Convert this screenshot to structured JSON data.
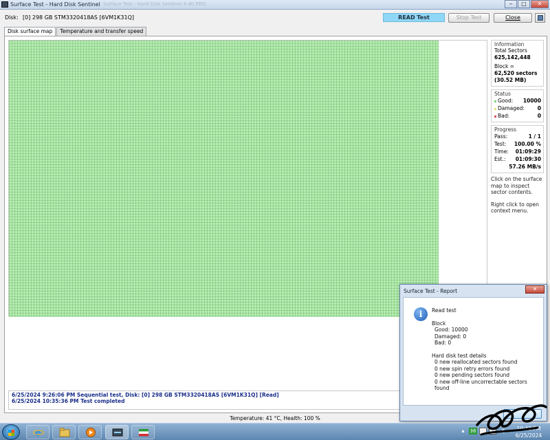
{
  "window": {
    "title": "Surface Test - Hard Disk Sentinel",
    "ghost_title": "Surface Test - Hard Disk Sentinel 4.40 PRO"
  },
  "disk": {
    "label": "Disk:",
    "value": "[0] 298 GB  STM3320418AS [6VM1K31Q]"
  },
  "toolbar": {
    "mode": "READ Test",
    "stop_label": "Stop Test",
    "close_label": "Close"
  },
  "tabs": [
    {
      "label": "Disk surface map"
    },
    {
      "label": "Temperature and transfer speed"
    }
  ],
  "surface_map": {
    "block_status": "good",
    "good_color": "#b7edb1",
    "gridline_color": "#78be78",
    "progress_fraction": 1.0
  },
  "information": {
    "title": "Information",
    "total_sectors_label": "Total Sectors",
    "total_sectors": "625,142,448",
    "block_label": "Block =",
    "block_sectors": "62,520 sectors",
    "block_size": "(30.52 MB)"
  },
  "status": {
    "title": "Status",
    "rows": [
      {
        "label": "Good:",
        "value": "10000",
        "color": "#7fd27a"
      },
      {
        "label": "Damaged:",
        "value": "0",
        "color": "#e8e27a"
      },
      {
        "label": "Bad:",
        "value": "0",
        "color": "#e05050"
      }
    ]
  },
  "progress": {
    "title": "Progress",
    "rows": [
      {
        "label": "Pass:",
        "value": "1 / 1"
      },
      {
        "label": "Test:",
        "value": "100.00 %"
      },
      {
        "label": "Time:",
        "value": "01:09:29"
      },
      {
        "label": "Est.:",
        "value": "01:09:30"
      }
    ],
    "speed": "57.26 MB/s"
  },
  "notes": {
    "click": "Click on the surface map to inspect sector contents.",
    "right_click": "Right click to open context menu."
  },
  "log": [
    "6/25/2024  9:26:06 PM   Sequential test, Disk: [0] 298 GB  STM3320418AS [6VM1K31Q] [Read]",
    "6/25/2024  10:35:36 PM   Test completed"
  ],
  "statusbar": {
    "text": "Temperature: 41  °C,  Health: 100 %"
  },
  "report": {
    "title": "Surface Test - Report",
    "heading": "Read test",
    "block_title": "Block",
    "good": "Good: 10000",
    "damaged": "Damaged: 0",
    "bad": "Bad: 0",
    "details_title": "Hard disk test details",
    "details": [
      "0 new reallocated sectors found",
      "0 new spin retry errors found",
      "0 new pending sectors found",
      "0 new off-line uncorrectable sectors found"
    ]
  },
  "taskbar": {
    "tray_temp": "36",
    "time": "10:41 PM",
    "date": "6/25/2024",
    "icons": [
      "start-orb-icon",
      "ie-icon",
      "explorer-icon",
      "media-player-icon",
      "hdsentinel-icon",
      "flag-app-icon"
    ]
  }
}
